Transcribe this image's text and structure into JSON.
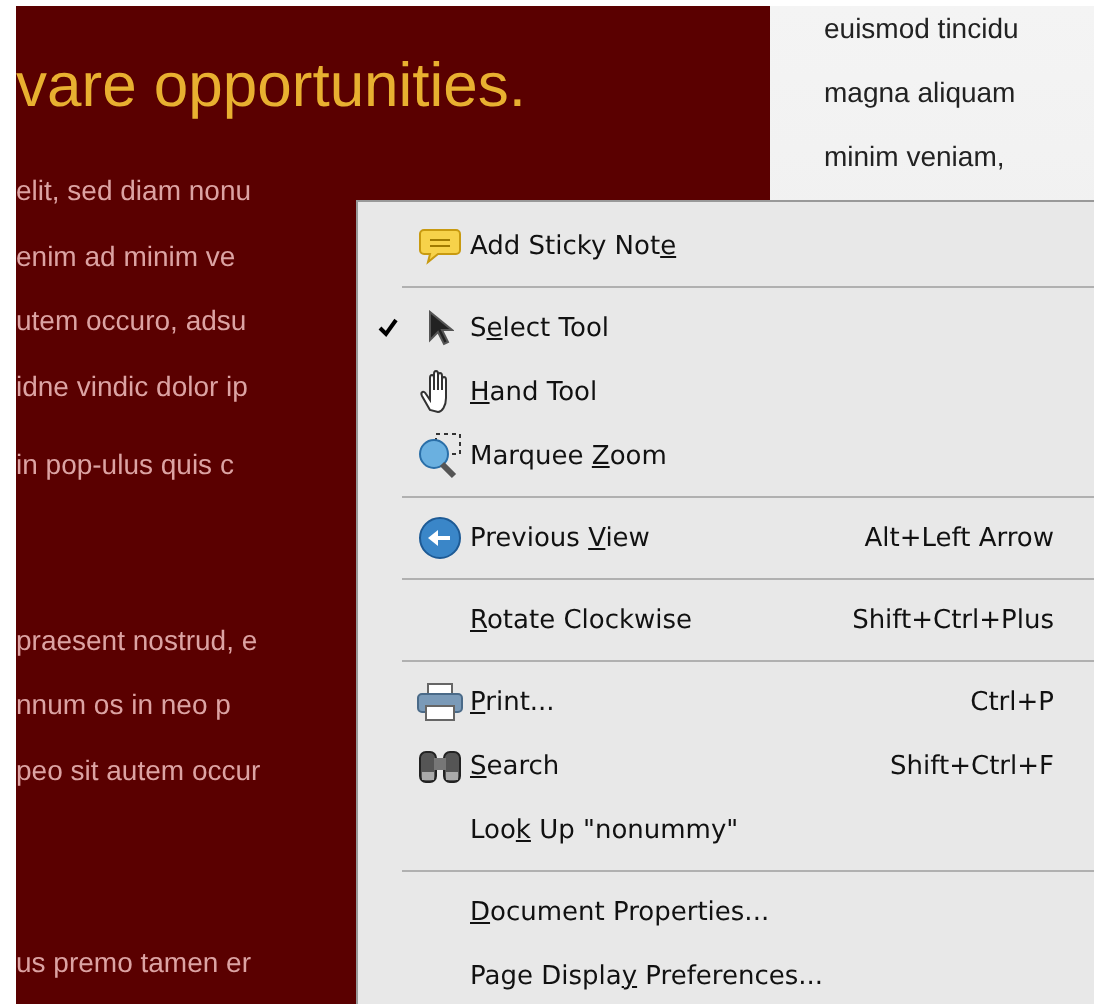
{
  "document": {
    "heading": "vare opportunities.",
    "paragraphs": [
      [
        "elit, sed diam nonu",
        "enim ad minim ve",
        "utem occuro, adsu",
        "idne vindic dolor ip",
        " in pop-ulus quis c"
      ],
      [
        "praesent nostrud, e",
        "nnum os in  neo p",
        "peo sit autem occur"
      ],
      [
        "us premo tamen er"
      ]
    ],
    "side_lines": [
      "euismod tincidu",
      "magna aliquam",
      "minim veniam,"
    ]
  },
  "context_menu": {
    "items": [
      {
        "kind": "item",
        "pre": "Add Sticky Not",
        "key": "e",
        "checked": false
      },
      {
        "kind": "separator"
      },
      {
        "kind": "item",
        "pre": "S",
        "key": "e",
        "post": "lect Tool",
        "checked": true
      },
      {
        "kind": "item",
        "key": "H",
        "post": "and Tool",
        "checked": false
      },
      {
        "kind": "item",
        "pre": "Marquee ",
        "key": "Z",
        "post": "oom",
        "checked": false
      },
      {
        "kind": "separator"
      },
      {
        "kind": "item",
        "pre": "Previous ",
        "key": "V",
        "post": "iew",
        "shortcut": "Alt+Left Arrow",
        "checked": false
      },
      {
        "kind": "separator"
      },
      {
        "kind": "item",
        "key": "R",
        "post": "otate Clockwise",
        "shortcut": "Shift+Ctrl+Plus",
        "checked": false
      },
      {
        "kind": "separator"
      },
      {
        "kind": "item",
        "key": "P",
        "post": "rint...",
        "shortcut": "Ctrl+P",
        "checked": false
      },
      {
        "kind": "item",
        "key": "S",
        "post": "earch",
        "shortcut": "Shift+Ctrl+F",
        "checked": false
      },
      {
        "kind": "item",
        "pre": "Loo",
        "key": "k",
        "post": " Up \"nonummy\"",
        "checked": false
      },
      {
        "kind": "separator"
      },
      {
        "kind": "item",
        "key": "D",
        "post": "ocument Properties...",
        "checked": false
      },
      {
        "kind": "item",
        "pre": "Page Displa",
        "key": "y",
        "post": " Preferences...",
        "checked": false
      }
    ]
  }
}
